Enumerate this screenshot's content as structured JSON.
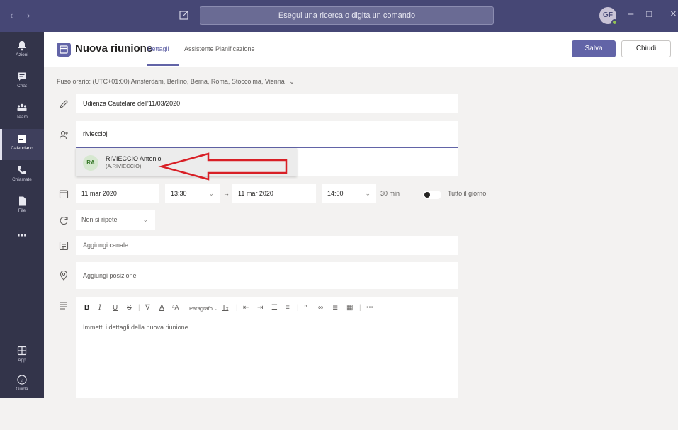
{
  "titlebar": {
    "search_placeholder": "Esegui una ricerca o digita un comando",
    "avatar_initials": "GF",
    "back_icon": "chevron-left-icon",
    "forward_icon": "chevron-right-icon"
  },
  "rail": {
    "items": [
      {
        "label": "Azioni",
        "icon": "bell-icon",
        "active": false
      },
      {
        "label": "Chat",
        "icon": "chat-icon",
        "active": false
      },
      {
        "label": "Team",
        "icon": "team-icon",
        "active": false
      },
      {
        "label": "Calendario",
        "icon": "calendar-icon",
        "active": true
      },
      {
        "label": "Chiamate",
        "icon": "phone-icon",
        "active": false
      },
      {
        "label": "File",
        "icon": "file-icon",
        "active": false
      },
      {
        "label": "",
        "icon": "more-icon",
        "active": false
      },
      {
        "label": "App",
        "icon": "apps-icon",
        "active": false
      },
      {
        "label": "Guida",
        "icon": "help-icon",
        "active": false
      }
    ]
  },
  "header": {
    "title": "Nuova riunione",
    "tabs": [
      "Dettagli",
      "Assistente Pianificazione"
    ],
    "save_label": "Salva",
    "close_label": "Chiudi"
  },
  "timezone": "Fuso orario: (UTC+01:00) Amsterdam, Berlino, Berna, Roma, Stoccolma, Vienna",
  "form": {
    "title_value": "Udienza Cautelare dell'11/03/2020",
    "attendees_value": "riviecciο",
    "suggestion": {
      "initials": "RA",
      "name": "RIVIECCIO Antonio",
      "id": "(A.RIVIECCIO)"
    },
    "start_date": "11 mar 2020",
    "start_time": "13:30",
    "end_date": "11 mar 2020",
    "end_time": "14:00",
    "duration": "30 min",
    "all_day_label": "Tutto il giorno",
    "repeat_value": "Non si ripete",
    "channel_placeholder": "Aggiungi canale",
    "location_placeholder": "Aggiungi posizione",
    "paragraph_label": "Paragrafo",
    "details_placeholder": "Immetti i dettagli della nuova riunione"
  },
  "colors": {
    "titlebar": "#464775",
    "rail": "#33344a",
    "accent": "#6264a7",
    "annotation_arrow": "#d81f26"
  }
}
